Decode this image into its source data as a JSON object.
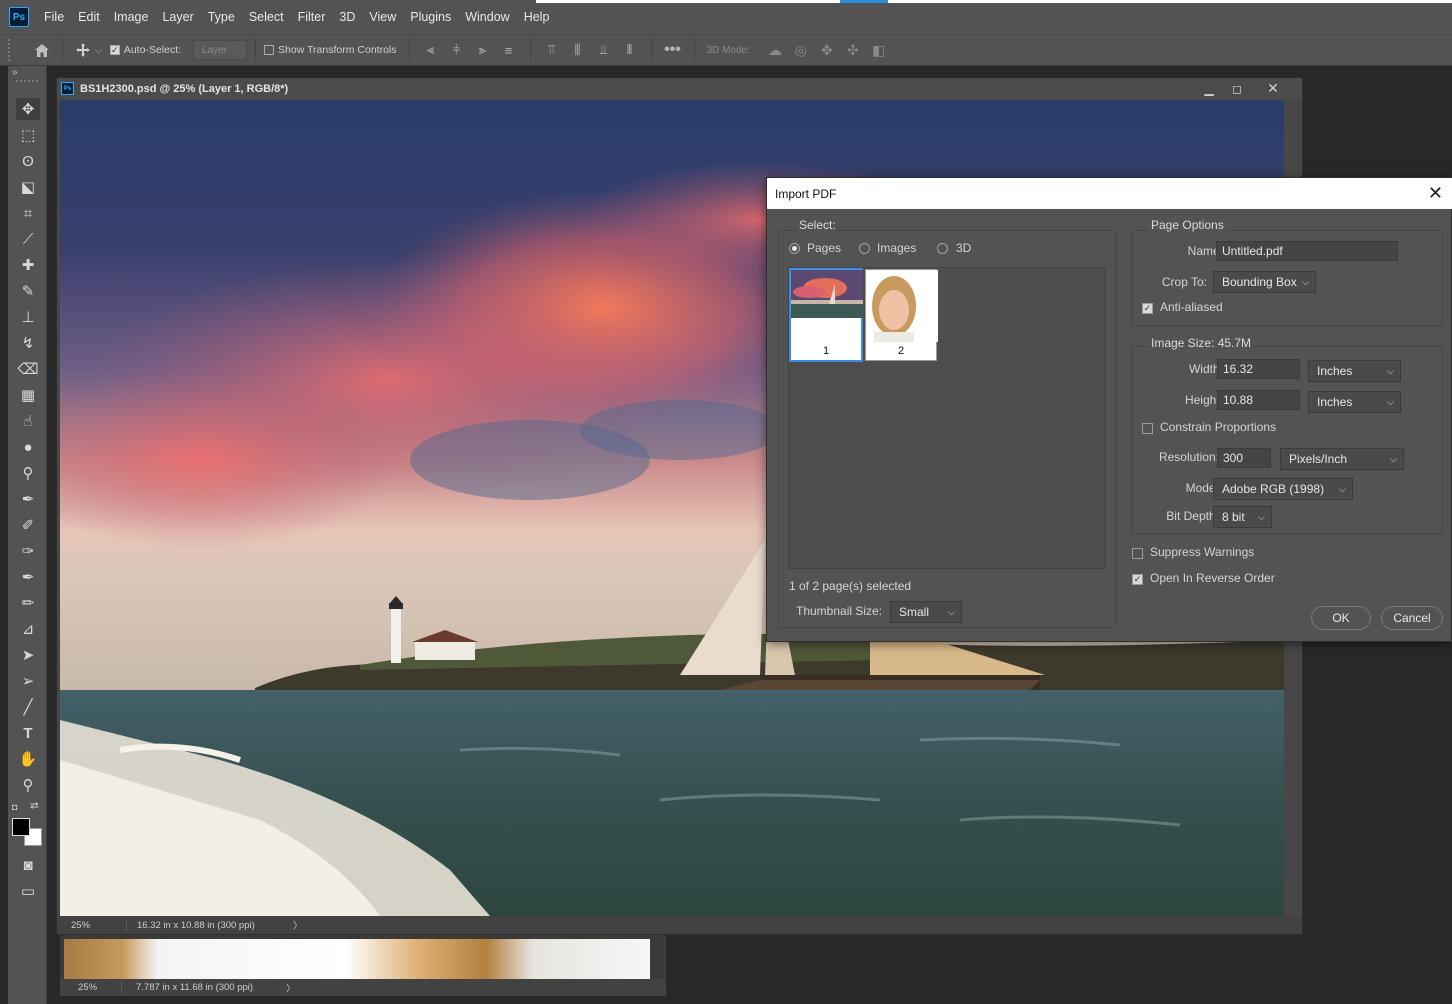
{
  "menu": [
    "File",
    "Edit",
    "Image",
    "Layer",
    "Type",
    "Select",
    "Filter",
    "3D",
    "View",
    "Plugins",
    "Window",
    "Help"
  ],
  "options": {
    "auto_select_label": "Auto-Select:",
    "layer_dropdown": "Layer",
    "show_transform_label": "Show Transform Controls",
    "mode_3d_label": "3D Mode:"
  },
  "document": {
    "title": "BS1H2300.psd @ 25% (Layer 1, RGB/8*)",
    "zoom": "25%",
    "size_info": "16.32 in x 10.88 in (300 ppi)"
  },
  "back_document": {
    "zoom": "25%",
    "size_info": "7.787 in x 11.68 in (300 ppi)"
  },
  "dialog": {
    "title": "Import PDF",
    "select_legend": "Select:",
    "radio_pages": "Pages",
    "radio_images": "Images",
    "radio_3d": "3D",
    "thumb_1": "1",
    "thumb_2": "2",
    "selection_status": "1 of 2 page(s) selected",
    "thumbnail_size_label": "Thumbnail Size:",
    "thumbnail_size_value": "Small",
    "page_options_legend": "Page Options",
    "name_label": "Name:",
    "name_value": "Untitled.pdf",
    "crop_label": "Crop To:",
    "crop_value": "Bounding Box",
    "anti_aliased_label": "Anti-aliased",
    "image_size_legend": "Image Size: 45.7M",
    "width_label": "Width:",
    "width_value": "16.32",
    "width_unit": "Inches",
    "height_label": "Height:",
    "height_value": "10.88",
    "height_unit": "Inches",
    "constrain_label": "Constrain Proportions",
    "resolution_label": "Resolution:",
    "resolution_value": "300",
    "resolution_unit": "Pixels/Inch",
    "mode_label": "Mode:",
    "mode_value": "Adobe RGB (1998)",
    "bit_depth_label": "Bit Depth:",
    "bit_depth_value": "8 bit",
    "suppress_label": "Suppress Warnings",
    "reverse_label": "Open In Reverse Order",
    "ok_label": "OK",
    "cancel_label": "Cancel"
  },
  "colors": {
    "app_bg": "#282828",
    "panel": "#535353",
    "accent": "#31a8ff",
    "selection": "#3a8ee6"
  }
}
